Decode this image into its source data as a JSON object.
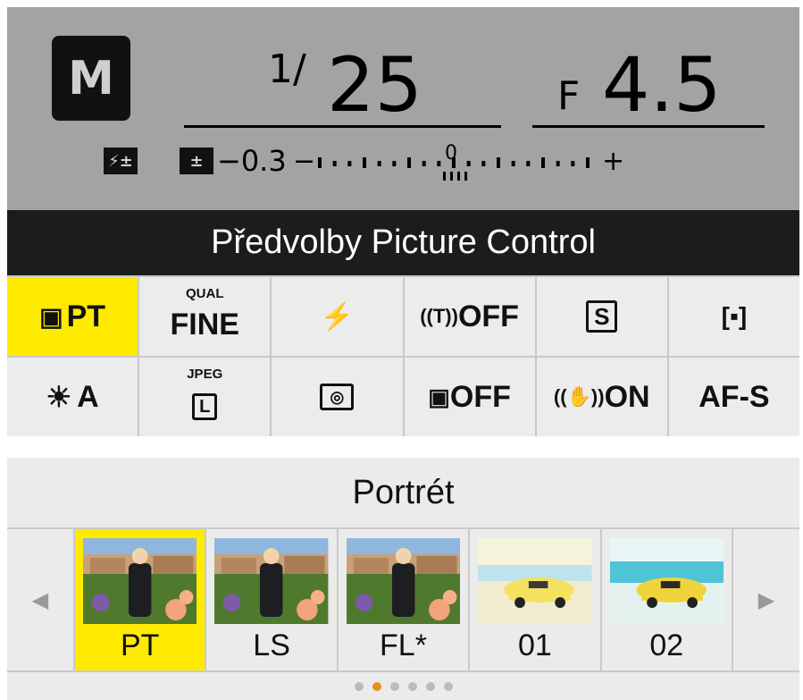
{
  "exposure": {
    "mode": "M",
    "shutter_prefix": "1/",
    "shutter_value": "25",
    "aperture_prefix": "F",
    "aperture_value": "4.5",
    "flash_comp_icon": "flash-compensation-icon",
    "exp_comp_icon": "exposure-compensation-icon",
    "exp_comp_value": "−0.3",
    "scale_zero": "0",
    "scale_minus": "−",
    "scale_plus": "+",
    "meter_level": -0.3
  },
  "title": "Předvolby Picture Control",
  "grid": {
    "row1": [
      {
        "id": "picture-control",
        "label": "PT",
        "icon": "picture-control-icon",
        "selected": true
      },
      {
        "id": "image-quality",
        "small": "QUAL",
        "label": "FINE"
      },
      {
        "id": "flash-mode",
        "icon": "flash-icon"
      },
      {
        "id": "wireless",
        "label": "OFF",
        "icon": "wireless-icon"
      },
      {
        "id": "release-mode",
        "label": "S",
        "icon": "single-frame-icon"
      },
      {
        "id": "af-area",
        "icon": "af-area-icon"
      }
    ],
    "row2": [
      {
        "id": "white-balance",
        "label": "A",
        "icon": "sun-icon"
      },
      {
        "id": "image-size",
        "small": "JPEG",
        "label": "L",
        "icon": "image-size-icon"
      },
      {
        "id": "metering",
        "icon": "matrix-metering-icon"
      },
      {
        "id": "active-d-lighting",
        "label": "OFF",
        "icon": "active-d-lighting-icon"
      },
      {
        "id": "vibration-reduction",
        "label": "ON",
        "icon": "vibration-reduction-icon"
      },
      {
        "id": "focus-mode",
        "label": "AF-S"
      }
    ]
  },
  "portrait": {
    "title": "Portrét",
    "presets": [
      {
        "label": "PT",
        "thumb": "portrait",
        "selected": true
      },
      {
        "label": "LS",
        "thumb": "portrait"
      },
      {
        "label": "FL*",
        "thumb": "portrait"
      },
      {
        "label": "01",
        "thumb": "car-pale"
      },
      {
        "label": "02",
        "thumb": "car-blue"
      }
    ],
    "pager": {
      "count": 6,
      "active": 1
    }
  },
  "colors": {
    "accent": "#ffeb00",
    "page_dot": "#e8901e",
    "panel": "#a3a3a3",
    "title_bar": "#1c1c1c"
  }
}
